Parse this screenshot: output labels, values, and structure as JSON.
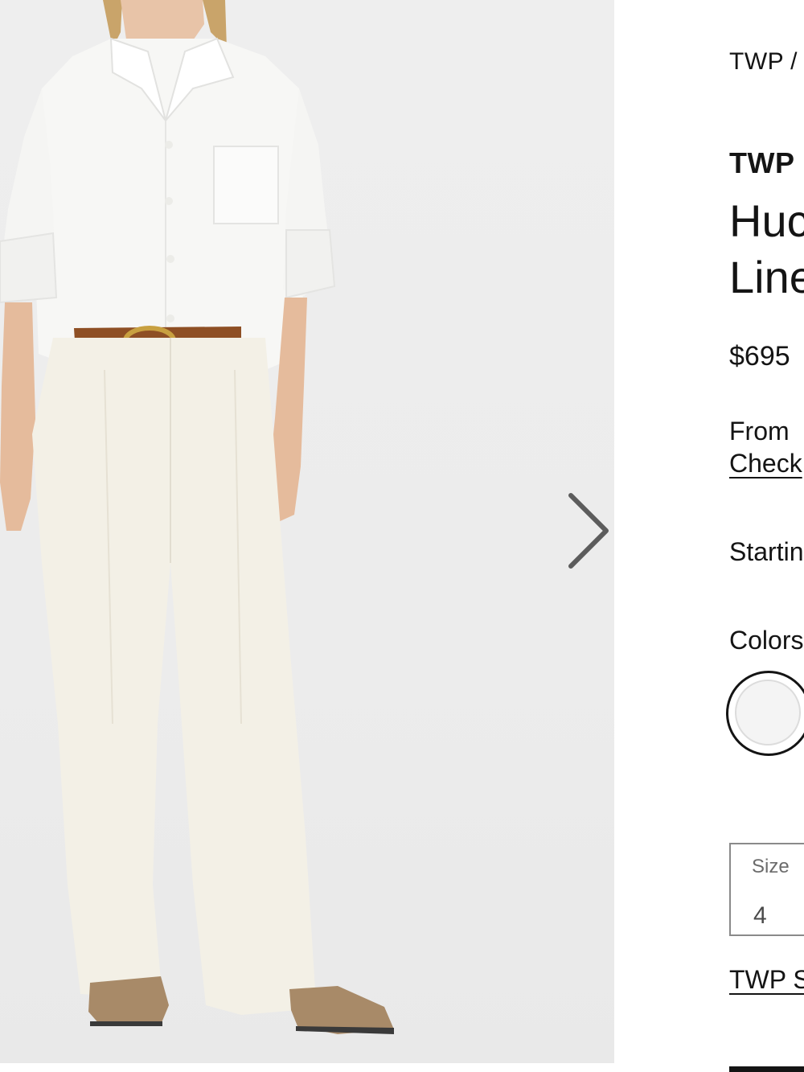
{
  "breadcrumb": {
    "brand": "TWP",
    "separator": "/"
  },
  "product": {
    "brand": "TWP",
    "title_line1": "Huc",
    "title_line2": "Line",
    "price": "$695"
  },
  "financing": {
    "line1": "From",
    "link": "Check"
  },
  "starting_text": "Startin",
  "colors": {
    "label": "Colors",
    "selected_swatch_color": "#f4f4f4"
  },
  "size": {
    "label": "Size",
    "value": "4"
  },
  "size_guide_link": "TWP S",
  "icons": {
    "next": "chevron-right-icon"
  },
  "colors_palette": {
    "background": "#ececec",
    "text": "#141414"
  }
}
